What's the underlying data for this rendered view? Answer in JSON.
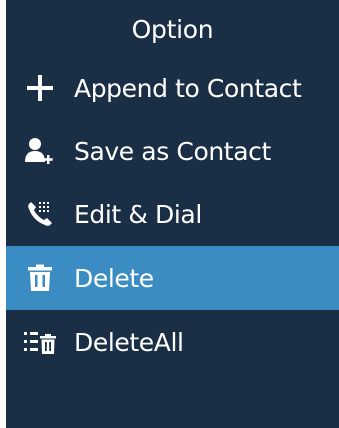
{
  "menu": {
    "title": "Option",
    "items": [
      {
        "label": "Append to Contact",
        "icon": "plus-icon",
        "selected": false
      },
      {
        "label": "Save as Contact",
        "icon": "add-contact-icon",
        "selected": false
      },
      {
        "label": "Edit & Dial",
        "icon": "phone-keypad-icon",
        "selected": false
      },
      {
        "label": "Delete",
        "icon": "trash-icon",
        "selected": true
      },
      {
        "label": "DeleteAll",
        "icon": "delete-all-icon",
        "selected": false
      }
    ]
  },
  "colors": {
    "background": "#1a2f46",
    "selected": "#3a8cc2",
    "text": "#ffffff"
  }
}
